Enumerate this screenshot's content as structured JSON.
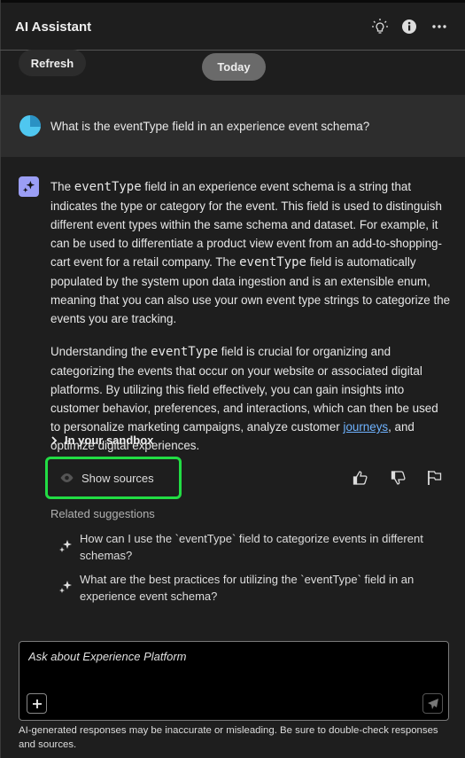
{
  "header": {
    "title": "AI Assistant",
    "icons": [
      "lightbulb-icon",
      "info-icon",
      "more-icon"
    ]
  },
  "refresh_label": "Refresh",
  "date_divider": "Today",
  "user_question": "What is the eventType field in an experience event schema?",
  "answer": {
    "p1": {
      "a": "The ",
      "code1": "eventType",
      "b": " field in an experience event schema is a string that indicates the type or category for the event. This field is used to distinguish different event types within the same schema and dataset. For example, it can be used to differentiate a product view event from an add-to-shopping-cart event for a retail company. The ",
      "code2": "eventType",
      "c": " field is automatically populated by the system upon data ingestion and is an extensible enum, meaning that you can also use your own event type strings to categorize the events you are tracking."
    },
    "p2": {
      "a": "Understanding the ",
      "code1": "eventType",
      "b": " field is crucial for organizing and categorizing the events that occur on your website or associated digital platforms. By utilizing this field effectively, you can gain insights into customer behavior, preferences, and interactions, which can then be used to personalize marketing campaigns, analyze customer ",
      "link": "journeys",
      "c": ", and optimize digital experiences."
    }
  },
  "sandbox_label": "In your sandbox",
  "show_sources_label": "Show sources",
  "related_title": "Related suggestions",
  "suggestions": [
    "How can I use the `eventType` field to categorize events in different schemas?",
    "What are the best practices for utilizing the `eventType` field in an experience event schema?"
  ],
  "input": {
    "placeholder": "Ask about Experience Platform",
    "value": ""
  },
  "disclaimer": "AI-generated responses may be inaccurate or misleading. Be sure to double-check responses and sources.",
  "colors": {
    "highlight": "#22dd44",
    "link": "#6fb3ff",
    "ai_icon": "#9b9ef5",
    "avatar": "#4fc7f0"
  }
}
